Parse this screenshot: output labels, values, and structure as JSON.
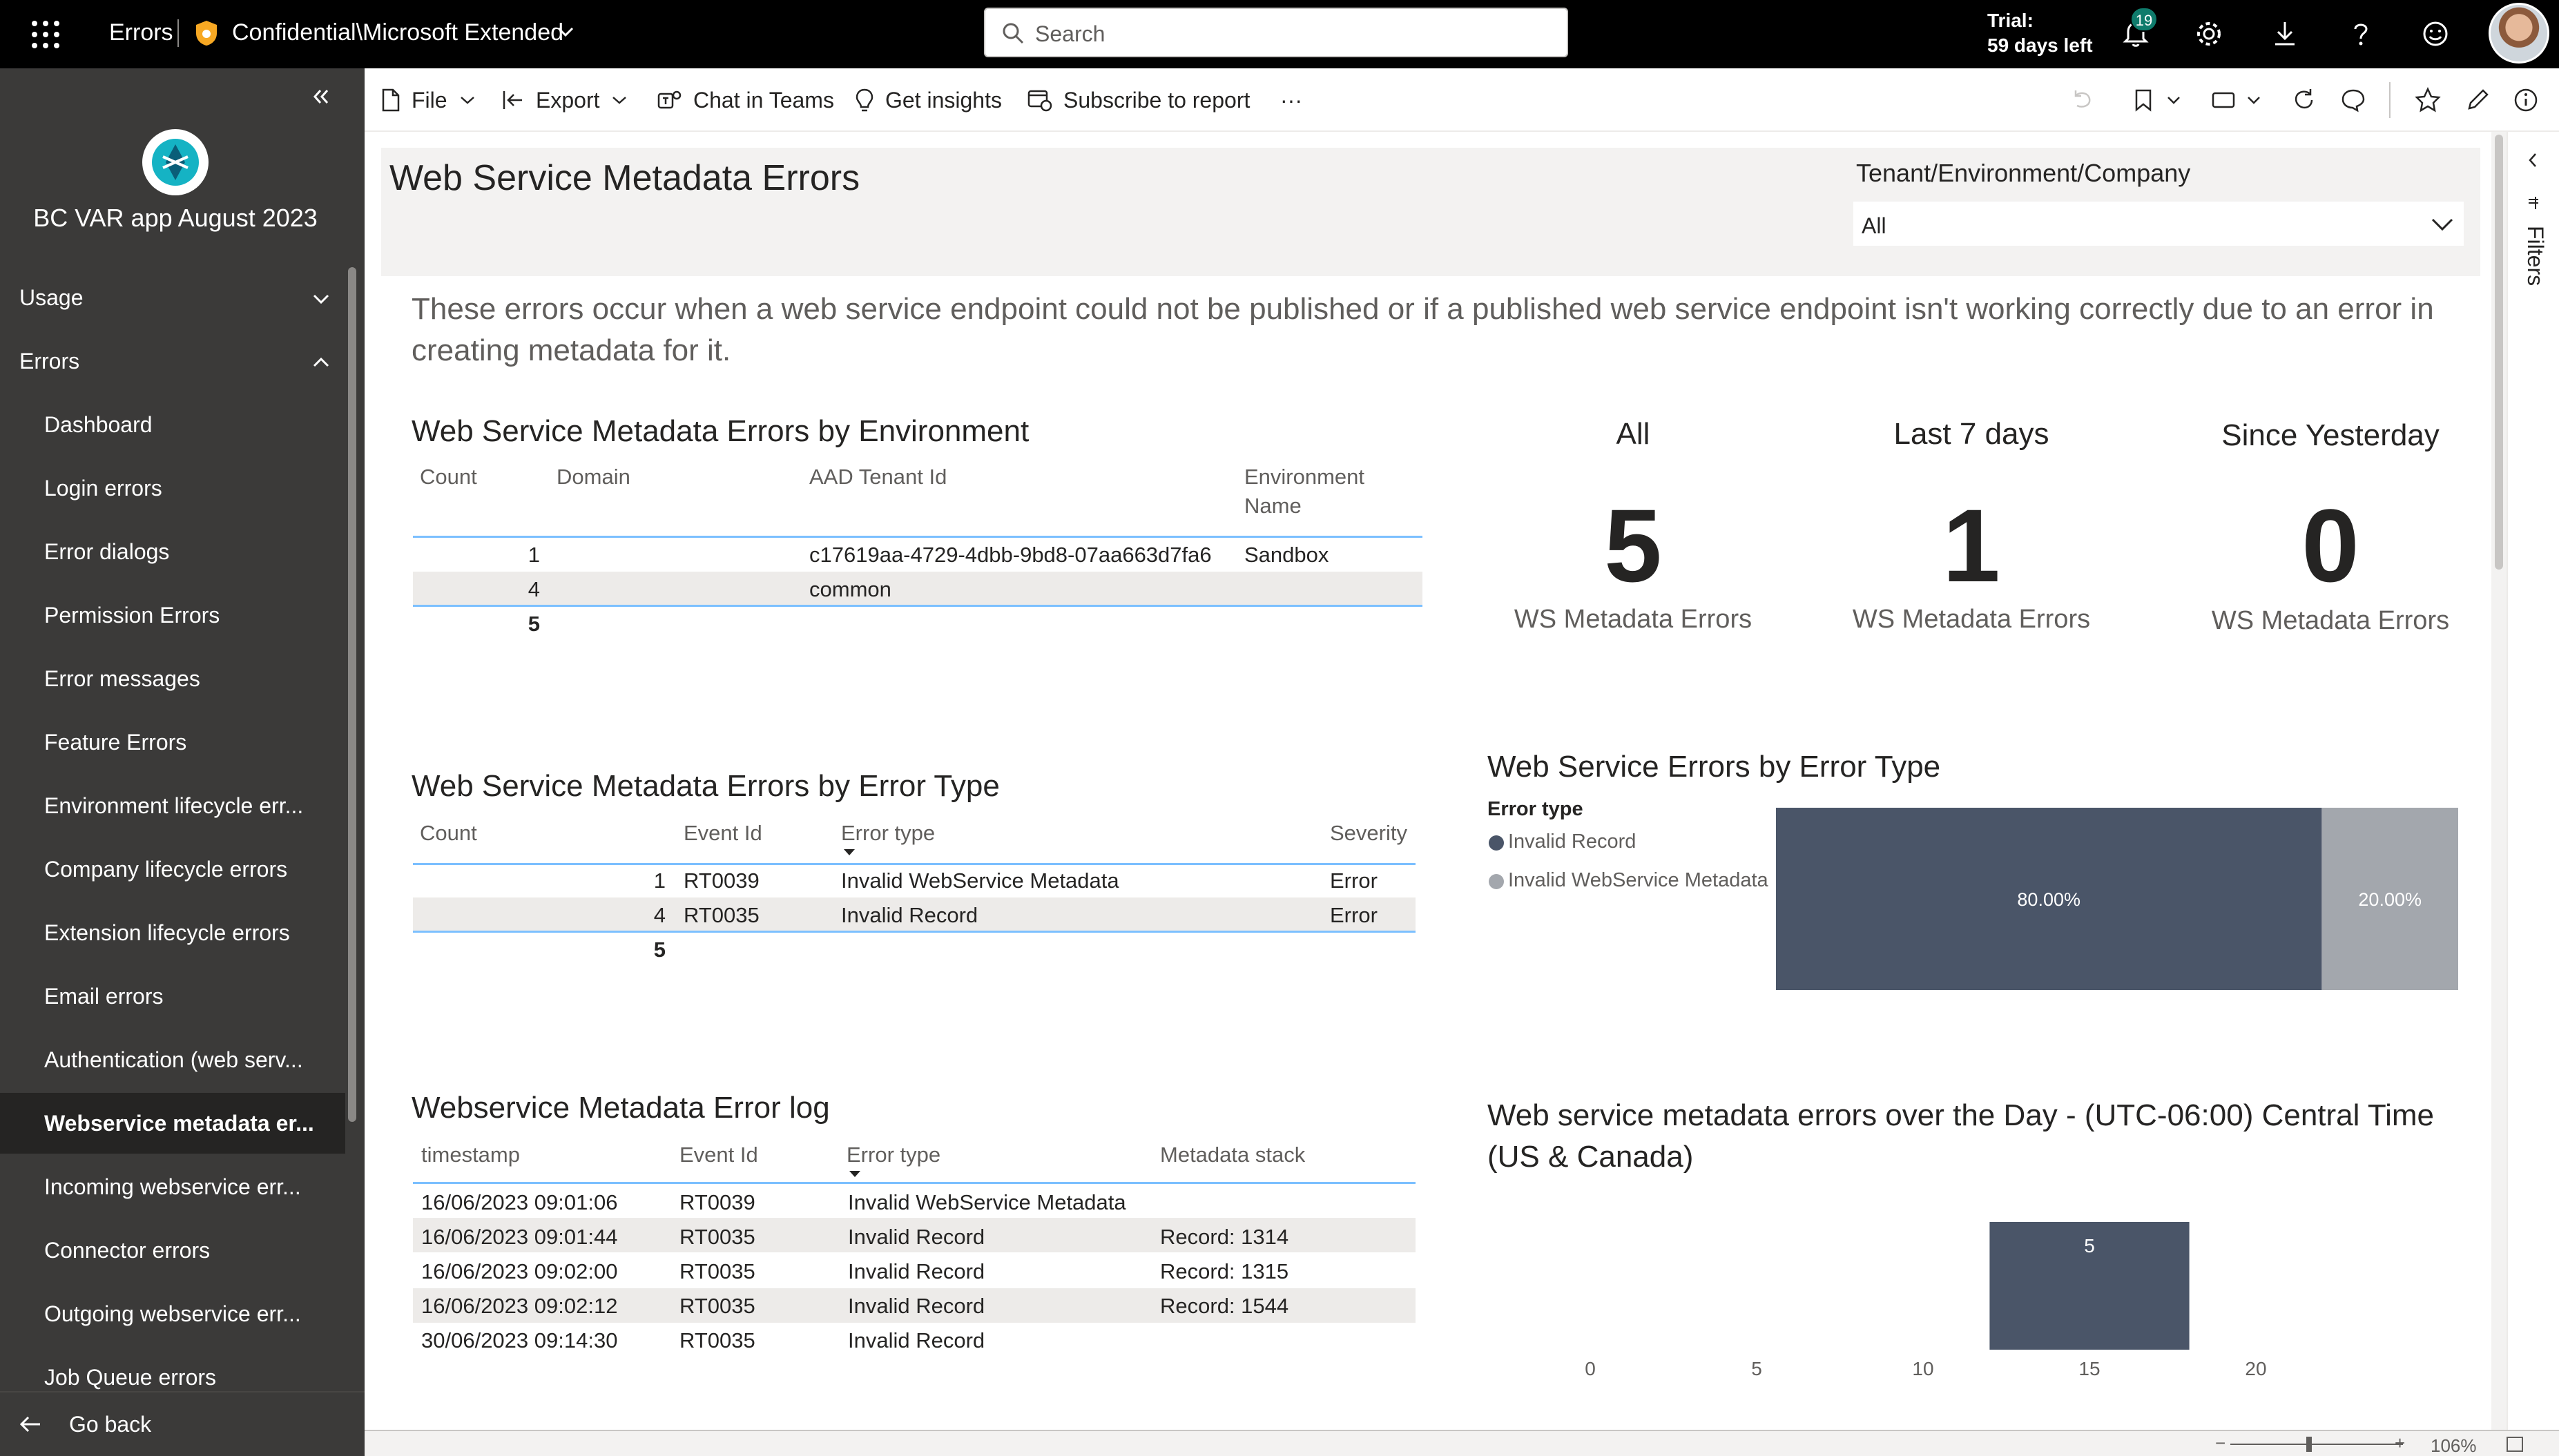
{
  "topbar": {
    "app_name": "Errors",
    "sensitivity_label": "Confidential\\Microsoft Extended",
    "search_placeholder": "Search",
    "trial_line1": "Trial:",
    "trial_line2": "59 days left",
    "notification_count": "19"
  },
  "sidebar": {
    "app_title": "BC VAR app August 2023",
    "sections": [
      {
        "label": "Usage",
        "expanded": false
      },
      {
        "label": "Errors",
        "expanded": true
      }
    ],
    "items": [
      {
        "label": "Dashboard"
      },
      {
        "label": "Login errors"
      },
      {
        "label": "Error dialogs"
      },
      {
        "label": "Permission Errors"
      },
      {
        "label": "Error messages"
      },
      {
        "label": "Feature Errors"
      },
      {
        "label": "Environment lifecycle err..."
      },
      {
        "label": "Company lifecycle errors"
      },
      {
        "label": "Extension lifecycle errors"
      },
      {
        "label": "Email errors"
      },
      {
        "label": "Authentication (web serv..."
      },
      {
        "label": "Webservice metadata er...",
        "active": true
      },
      {
        "label": "Incoming webservice err..."
      },
      {
        "label": "Connector errors"
      },
      {
        "label": "Outgoing webservice err..."
      },
      {
        "label": "Job Queue errors"
      }
    ],
    "go_back": "Go back"
  },
  "toolbar": {
    "file": "File",
    "export": "Export",
    "chat_in_teams": "Chat in Teams",
    "get_insights": "Get insights",
    "subscribe": "Subscribe to report",
    "more": "···"
  },
  "report": {
    "title": "Web Service Metadata Errors",
    "slicer": {
      "label": "Tenant/Environment/Company",
      "value": "All"
    },
    "description": "These errors occur when a web service endpoint could not be published or if a published web service endpoint isn't working correctly due to an error in creating metadata for it.",
    "by_environment": {
      "title": "Web Service Metadata Errors by Environment",
      "columns": [
        "Count",
        "Domain",
        "AAD Tenant Id",
        "Environment Name"
      ],
      "rows": [
        {
          "count": "1",
          "domain": "",
          "tenant": "c17619aa-4729-4dbb-9bd8-07aa663d7fa6",
          "env": "Sandbox"
        },
        {
          "count": "4",
          "domain": "",
          "tenant": "common",
          "env": ""
        }
      ],
      "total": "5"
    },
    "by_error_type": {
      "title": "Web Service Metadata Errors by Error Type",
      "columns": [
        "Count",
        "Event Id",
        "Error type",
        "Severity"
      ],
      "rows": [
        {
          "count": "1",
          "event": "RT0039",
          "type": "Invalid WebService Metadata",
          "severity": "Error"
        },
        {
          "count": "4",
          "event": "RT0035",
          "type": "Invalid Record",
          "severity": "Error"
        }
      ],
      "total": "5"
    },
    "error_log": {
      "title": "Webservice Metadata Error log",
      "columns": [
        "timestamp",
        "Event Id",
        "Error type",
        "Metadata stack"
      ],
      "rows": [
        {
          "ts": "16/06/2023 09:01:06",
          "event": "RT0039",
          "type": "Invalid WebService Metadata",
          "stack": ""
        },
        {
          "ts": "16/06/2023 09:01:44",
          "event": "RT0035",
          "type": "Invalid Record",
          "stack": "Record: 1314"
        },
        {
          "ts": "16/06/2023 09:02:00",
          "event": "RT0035",
          "type": "Invalid Record",
          "stack": "Record: 1315"
        },
        {
          "ts": "16/06/2023 09:02:12",
          "event": "RT0035",
          "type": "Invalid Record",
          "stack": "Record: 1544"
        },
        {
          "ts": "30/06/2023 09:14:30",
          "event": "RT0035",
          "type": "Invalid Record",
          "stack": ""
        }
      ]
    },
    "kpis": [
      {
        "heading": "All",
        "value": "5",
        "label": "WS Metadata Errors"
      },
      {
        "heading": "Last 7 days",
        "value": "1",
        "label": "WS Metadata Errors"
      },
      {
        "heading": "Since Yesterday",
        "value": "0",
        "label": "WS Metadata Errors"
      }
    ],
    "zoom": "106%"
  },
  "colors": {
    "bar_dark": "#4a5568",
    "bar_light": "#a3a7ad",
    "accent_line": "#118dff"
  },
  "chart_data": [
    {
      "type": "bar",
      "title": "Web Service Errors by Error Type",
      "legend_title": "Error type",
      "legend_position": "left",
      "stacked_percent": true,
      "series": [
        {
          "name": "Invalid Record",
          "value": 80.0,
          "label": "80.00%",
          "color": "#4a5568"
        },
        {
          "name": "Invalid WebService Metadata",
          "value": 20.0,
          "label": "20.00%",
          "color": "#a3a7ad"
        }
      ]
    },
    {
      "type": "bar",
      "title": "Web service metadata errors over the Day - (UTC-06:00) Central Time (US & Canada)",
      "x_ticks": [
        "0",
        "5",
        "10",
        "15",
        "20"
      ],
      "xlim": [
        0,
        21
      ],
      "bars": [
        {
          "x_start": 12,
          "x_end": 18,
          "value": 5,
          "label": "5"
        }
      ]
    }
  ]
}
